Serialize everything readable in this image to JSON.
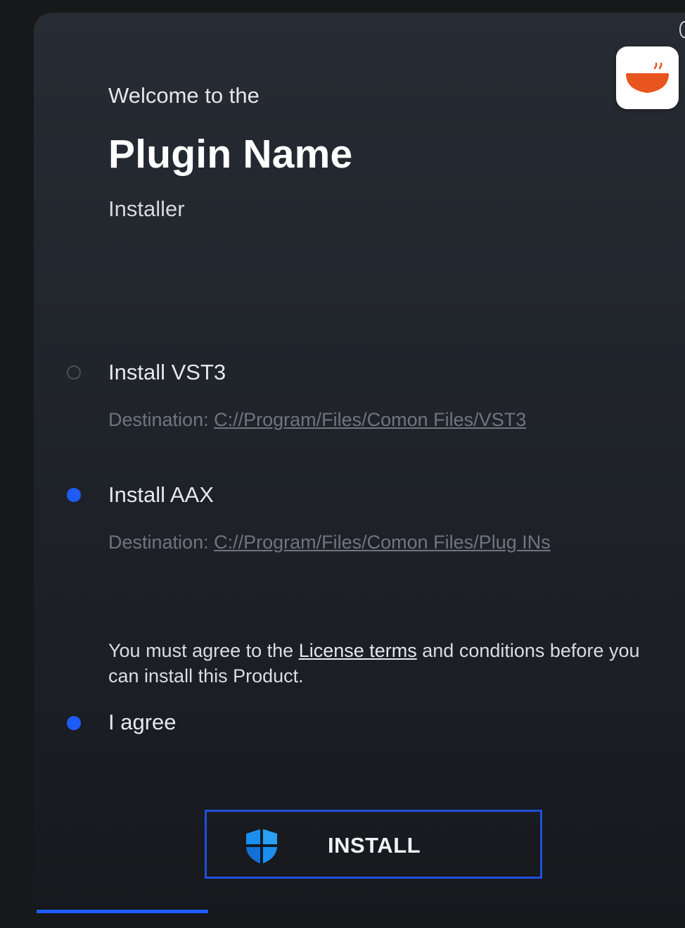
{
  "header": {
    "welcome": "Welcome to the",
    "plugin_name": "Plugin Name",
    "subtitle": "Installer"
  },
  "app_icon": {
    "icon": "bowl-icon",
    "colors": {
      "bowl": "#e8551e",
      "steam": "#e8551e"
    }
  },
  "options": [
    {
      "label": "Install VST3",
      "selected": false,
      "destination_label": "Destination: ",
      "destination_path": "C://Program/Files/Comon Files/VST3"
    },
    {
      "label": "Install AAX",
      "selected": true,
      "destination_label": "Destination: ",
      "destination_path": "C://Program/Files/Comon Files/Plug INs"
    }
  ],
  "license": {
    "text_before": "You must agree to the ",
    "link": "License terms",
    "text_after": " and conditions before you can install this Product.",
    "agree_label": "I agree",
    "agreed": true
  },
  "install_button": {
    "label": "INSTALL",
    "icon": "shield-icon"
  },
  "progress": {
    "fraction": 0.265
  },
  "colors": {
    "accent": "#1f5cf5",
    "button_border": "#1f4fdc",
    "muted_text": "#6f7580"
  }
}
